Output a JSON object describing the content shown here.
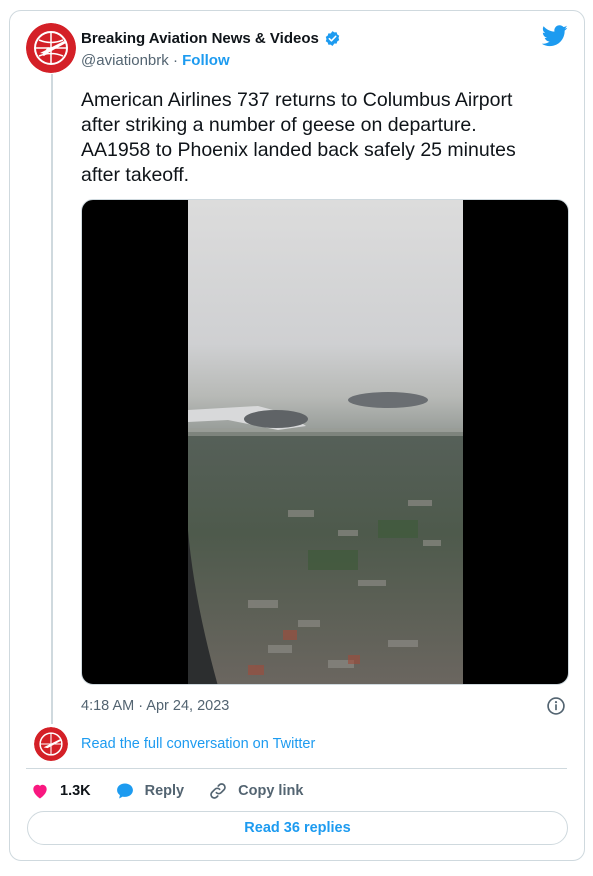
{
  "author": {
    "name": "Breaking Aviation News & Videos",
    "handle": "@aviationbrk",
    "separator": "·",
    "follow_label": "Follow",
    "verified": true
  },
  "tweet": {
    "text": "American Airlines 737 returns to Columbus Airport\nafter striking a number of geese on departure.\nAA1958 to Phoenix landed back safely 25 minutes\nafter takeoff.",
    "timestamp": "4:18 AM · Apr 24, 2023"
  },
  "conversation": {
    "link_label": "Read the full conversation on Twitter"
  },
  "actions": {
    "like_count": "1.3K",
    "reply_label": "Reply",
    "copy_label": "Copy link"
  },
  "replies_button": {
    "label": "Read 36 replies"
  },
  "icons": {
    "platform": "twitter-bird-icon",
    "verified": "verified-badge-icon",
    "info": "info-icon",
    "like": "heart-icon",
    "reply": "speech-bubble-icon",
    "copy": "link-icon"
  },
  "colors": {
    "accent": "#1d9bf0",
    "like": "#f91880",
    "muted_text": "#536471",
    "avatar_red": "#d42027",
    "border": "#cfd9de"
  }
}
